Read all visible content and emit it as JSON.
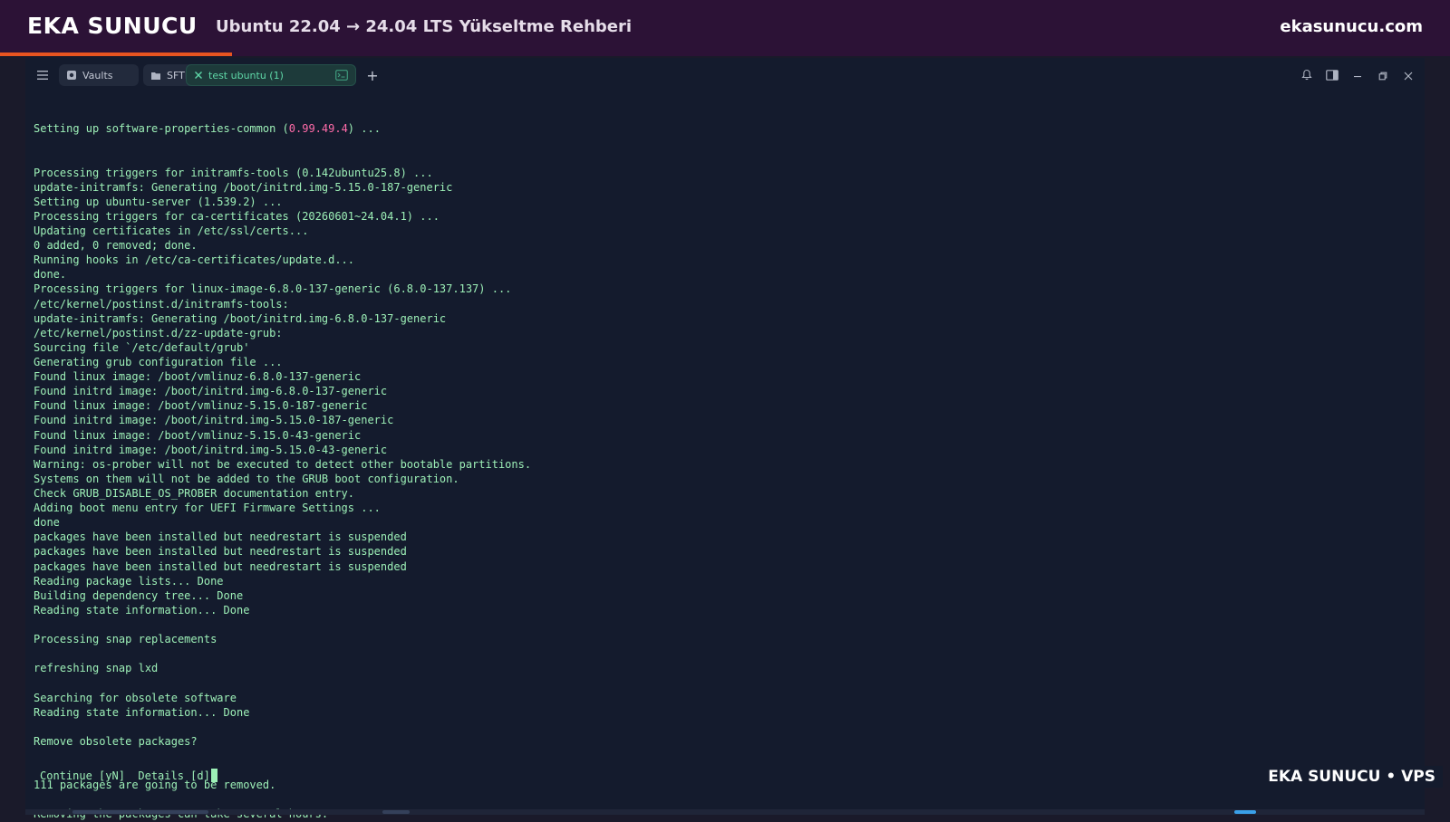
{
  "banner": {
    "brand": "EKA SUNUCU",
    "subtitle": "Ubuntu 22.04 → 24.04 LTS Yükseltme Rehberi",
    "site": "ekasunucu.com",
    "progress_fraction": 0.16,
    "background_color": "#2c1236",
    "accent_color": "#e95420"
  },
  "titlebar": {
    "menu_icon": "hamburger-menu-icon",
    "vaults_label": "Vaults",
    "sftp_label": "SFTP",
    "active_tab_label": "test ubuntu (1)",
    "new_tab_label": "+",
    "icons": [
      "bell-icon",
      "split-panel-icon",
      "minimize-icon",
      "restore-icon",
      "close-icon"
    ]
  },
  "terminal": {
    "text_color": "#9df0b7",
    "highlight_color": "#ff6ba8",
    "line1_prefix": "Setting up software-properties-common (",
    "line1_version": "0.99.49.4",
    "line1_suffix": ") ...",
    "lines": [
      "Processing triggers for initramfs-tools (0.142ubuntu25.8) ...",
      "update-initramfs: Generating /boot/initrd.img-5.15.0-187-generic",
      "Setting up ubuntu-server (1.539.2) ...",
      "Processing triggers for ca-certificates (20260601~24.04.1) ...",
      "Updating certificates in /etc/ssl/certs...",
      "0 added, 0 removed; done.",
      "Running hooks in /etc/ca-certificates/update.d...",
      "done.",
      "Processing triggers for linux-image-6.8.0-137-generic (6.8.0-137.137) ...",
      "/etc/kernel/postinst.d/initramfs-tools:",
      "update-initramfs: Generating /boot/initrd.img-6.8.0-137-generic",
      "/etc/kernel/postinst.d/zz-update-grub:",
      "Sourcing file `/etc/default/grub'",
      "Generating grub configuration file ...",
      "Found linux image: /boot/vmlinuz-6.8.0-137-generic",
      "Found initrd image: /boot/initrd.img-6.8.0-137-generic",
      "Found linux image: /boot/vmlinuz-5.15.0-187-generic",
      "Found initrd image: /boot/initrd.img-5.15.0-187-generic",
      "Found linux image: /boot/vmlinuz-5.15.0-43-generic",
      "Found initrd image: /boot/initrd.img-5.15.0-43-generic",
      "Warning: os-prober will not be executed to detect other bootable partitions.",
      "Systems on them will not be added to the GRUB boot configuration.",
      "Check GRUB_DISABLE_OS_PROBER documentation entry.",
      "Adding boot menu entry for UEFI Firmware Settings ...",
      "done",
      "packages have been installed but needrestart is suspended",
      "packages have been installed but needrestart is suspended",
      "packages have been installed but needrestart is suspended",
      "Reading package lists... Done",
      "Building dependency tree... Done",
      "Reading state information... Done",
      "",
      "Processing snap replacements",
      "",
      "refreshing snap lxd",
      "",
      "Searching for obsolete software",
      "Reading state information... Done",
      "",
      "Remove obsolete packages?",
      "",
      "",
      "111 packages are going to be removed.",
      "",
      "Removing the packages can take several hours."
    ],
    "prompt": "Continue [yN]  Details [d]"
  },
  "watermark": "EKA SUNUCU • VPS"
}
